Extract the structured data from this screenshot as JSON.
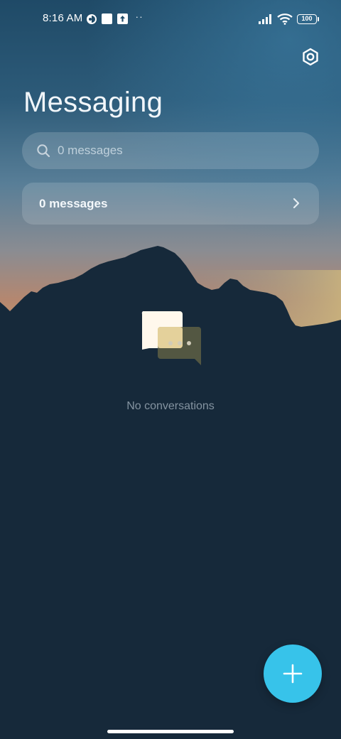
{
  "status_bar": {
    "time": "8:16 AM",
    "battery": "100",
    "icons": [
      "vpn-key-icon",
      "notification-square-icon",
      "upload-icon",
      "more-notifications-icon",
      "cell-signal-icon",
      "wifi-icon",
      "battery-icon"
    ]
  },
  "header": {
    "title": "Messaging",
    "settings_icon": "settings-icon"
  },
  "search": {
    "placeholder": "0 messages",
    "value": ""
  },
  "summary": {
    "label": "0 messages",
    "icon": "chevron-right-icon"
  },
  "empty_state": {
    "text": "No conversations",
    "icon": "chat-bubbles-icon"
  },
  "fab": {
    "icon": "plus-icon",
    "color": "#37c3ea"
  },
  "colors": {
    "background": "#16293a",
    "sky_top": "#2b5a7a",
    "sky_horizon": "#c98f6e",
    "accent": "#37c3ea"
  }
}
